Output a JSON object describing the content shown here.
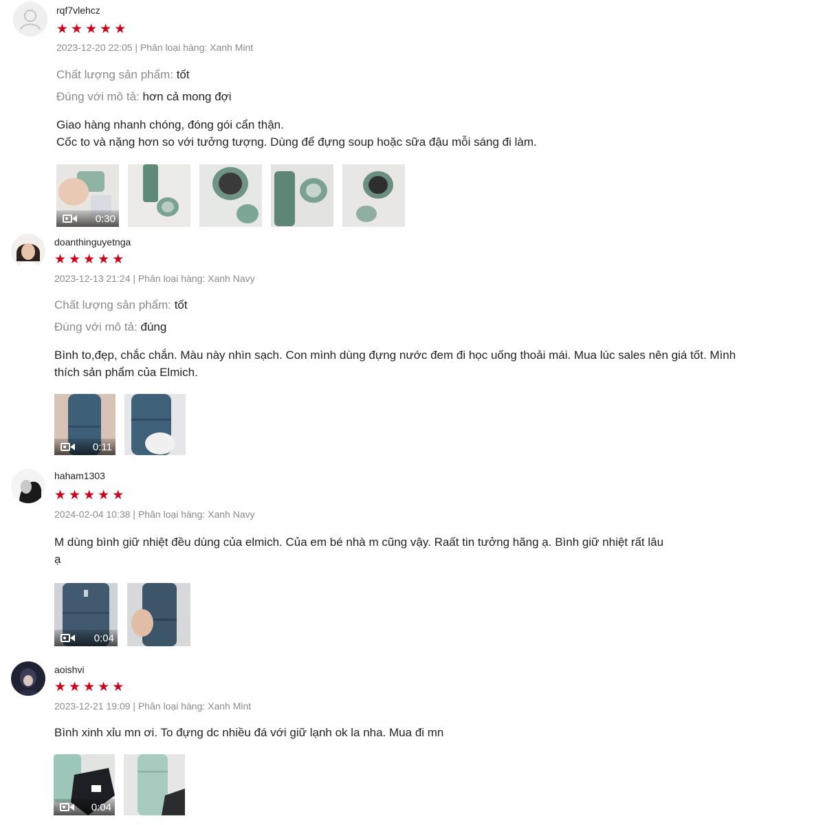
{
  "reviews": [
    {
      "username": "rqf7vlehcz",
      "rating": 5,
      "meta": "2023-12-20 22:05 | Phân loại hàng: Xanh Mint",
      "attributes": [
        {
          "key": "Chất lượng sản phẩm:",
          "value": "tốt"
        },
        {
          "key": "Đúng với mô tả:",
          "value": "hơn cả mong đợi"
        }
      ],
      "comment": [
        "Giao hàng nhanh chóng, đóng gói cẩn thận.",
        "Cốc to và nặng hơn so với tưởng tượng. Dùng để đựng soup hoặc sữa đậu mỗi sáng đi làm."
      ],
      "video_duration": "0:30"
    },
    {
      "username": "doanthinguyetnga",
      "rating": 5,
      "meta": "2023-12-13 21:24 | Phân loại hàng: Xanh Navy",
      "attributes": [
        {
          "key": "Chất lượng sản phẩm:",
          "value": "tốt"
        },
        {
          "key": "Đúng với mô tả:",
          "value": "đúng"
        }
      ],
      "comment": [
        "Bình to,đẹp, chắc chắn. Màu này nhìn sạch. Con mình dùng đựng nước đem đi học uống thoải mái. Mua lúc sales nên giá tốt. Mình",
        "thích sản phẩm của Elmich."
      ],
      "video_duration": "0:11"
    },
    {
      "username": "haham1303",
      "rating": 5,
      "meta": "2024-02-04 10:38 | Phân loại hàng: Xanh Navy",
      "attributes": [],
      "comment": [
        "M dùng bình giữ nhiệt đều dùng của elmich. Của em bé nhà m cũng vậy. Raất tin tưởng hãng ạ. Bình giữ nhiệt rất lâu",
        "ạ"
      ],
      "video_duration": "0:04"
    },
    {
      "username": "aoishvi",
      "rating": 5,
      "meta": "2023-12-21 19:09 | Phân loại hàng: Xanh Mint",
      "attributes": [],
      "comment": [
        "Bình xinh xỉu mn ơi. To đựng dc nhiều đá với giữ lạnh ok la nha. Mua đi mn"
      ],
      "video_duration": "0:04"
    }
  ],
  "icons": {
    "star": "★",
    "video": "video-camera-icon",
    "avatar_placeholder": "user-silhouette-icon"
  },
  "colors": {
    "star": "#d0011b",
    "meta_text": "#8a8a8a",
    "body_text": "#222222",
    "mint": "#6f9a86",
    "navy": "#3f5e74"
  }
}
